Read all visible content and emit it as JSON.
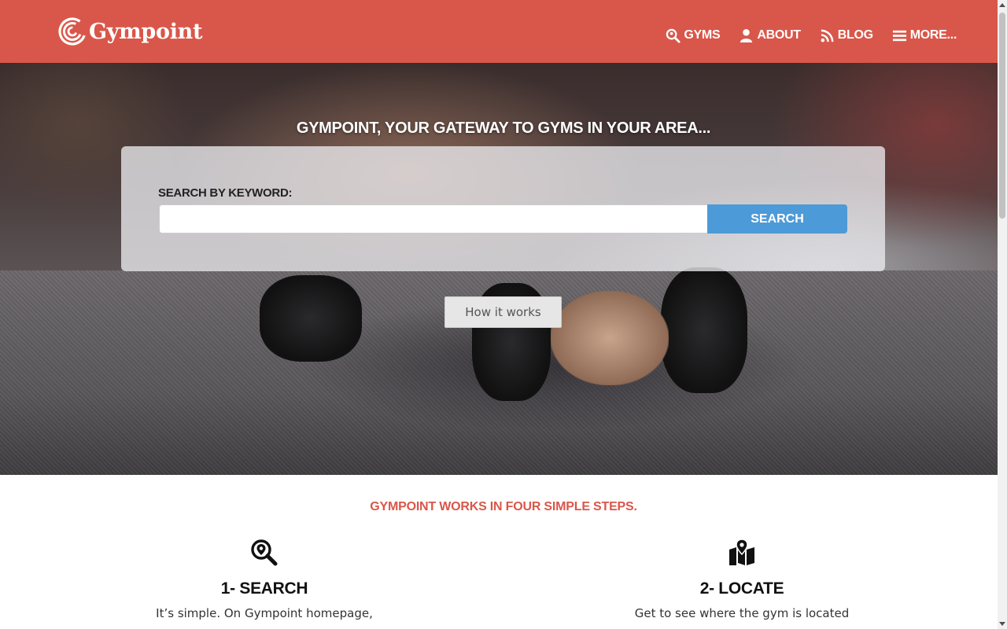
{
  "header": {
    "logo_text": "Gympoint",
    "bg_color": "#d9574a",
    "nav": [
      {
        "label": "GYMS",
        "icon": "search-icon"
      },
      {
        "label": "ABOUT",
        "icon": "user-icon"
      },
      {
        "label": "BLOG",
        "icon": "rss-icon"
      },
      {
        "label": "MORE...",
        "icon": "menu-icon"
      }
    ]
  },
  "hero": {
    "title": "GYMPOINT, YOUR GATEWAY TO GYMS IN YOUR AREA...",
    "search_label": "SEARCH BY KEYWORD:",
    "search_value": "",
    "search_button": "SEARCH",
    "search_button_color": "#4d9ad8",
    "how_button": "How it works"
  },
  "steps": {
    "heading": "GYMPOINT WORKS IN FOUR SIMPLE STEPS.",
    "heading_color": "#d9574a",
    "items": [
      {
        "title": "1- SEARCH",
        "text": "It’s simple. On Gympoint homepage,",
        "icon": "search-location-icon"
      },
      {
        "title": "2- LOCATE",
        "text": "Get to see where the gym is located",
        "icon": "map-pin-icon"
      }
    ]
  }
}
